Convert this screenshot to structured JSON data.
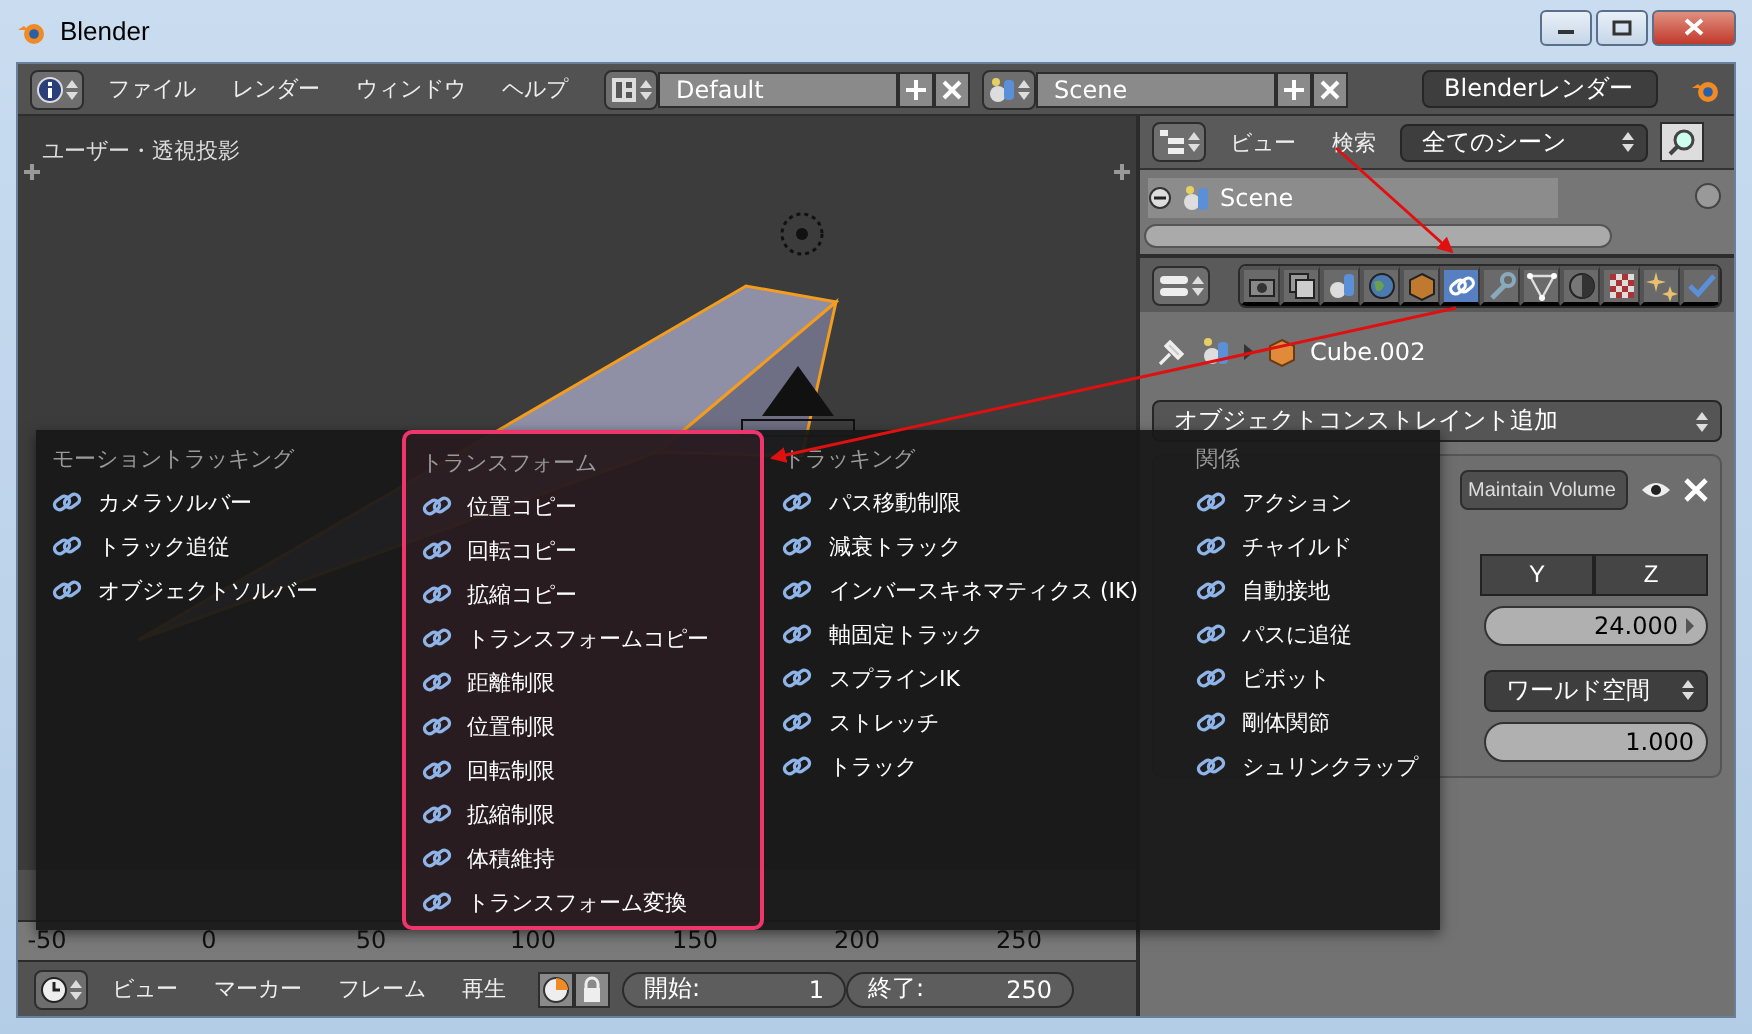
{
  "window": {
    "title": "Blender"
  },
  "top_bar": {
    "menu": [
      "ファイル",
      "レンダー",
      "ウィンドウ",
      "ヘルプ"
    ],
    "layout": "Default",
    "scene": "Scene",
    "engine": "Blenderレンダー"
  },
  "viewport": {
    "label": "ユーザー・透視投影"
  },
  "timeline": {
    "ruler": [
      "-50",
      "0",
      "50",
      "100",
      "150",
      "200",
      "250"
    ],
    "menu": [
      "ビュー",
      "マーカー",
      "フレーム",
      "再生"
    ],
    "start_label": "開始:",
    "start": "1",
    "end_label": "終了:",
    "end": "250"
  },
  "outliner": {
    "menu": [
      "ビュー",
      "検索"
    ],
    "filter": "全てのシーン",
    "tree": [
      {
        "label": "Scene",
        "expanded": true
      }
    ]
  },
  "properties": {
    "tabs": [
      {
        "kind": "render",
        "selected": false
      },
      {
        "kind": "layers",
        "selected": false
      },
      {
        "kind": "scene",
        "selected": false
      },
      {
        "kind": "world",
        "selected": false
      },
      {
        "kind": "object",
        "selected": false
      },
      {
        "kind": "constraints",
        "selected": true
      },
      {
        "kind": "modifiers",
        "selected": false
      },
      {
        "kind": "data",
        "selected": false
      },
      {
        "kind": "material",
        "selected": false
      },
      {
        "kind": "texture",
        "selected": false
      },
      {
        "kind": "particles",
        "selected": false
      },
      {
        "kind": "physics",
        "selected": false
      }
    ],
    "breadcrumb": "Cube.002",
    "add_constraint": "オブジェクトコンストレイント追加",
    "constraint": {
      "name": "Maintain Volume",
      "axes": [
        {
          "label": "Y",
          "selected": false
        },
        {
          "label": "Z",
          "selected": false
        }
      ],
      "volume": "24.000",
      "space": "ワールド空間",
      "influence": "1.000"
    }
  },
  "constraint_menu": {
    "columns": [
      {
        "title": "モーショントラッキング",
        "highlighted": false,
        "items": [
          "カメラソルバー",
          "トラック追従",
          "オブジェクトソルバー"
        ]
      },
      {
        "title": "トランスフォーム",
        "highlighted": true,
        "items": [
          "位置コピー",
          "回転コピー",
          "拡縮コピー",
          "トランスフォームコピー",
          "距離制限",
          "位置制限",
          "回転制限",
          "拡縮制限",
          "体積維持",
          "トランスフォーム変換"
        ]
      },
      {
        "title": "トラッキング",
        "highlighted": false,
        "items": [
          "パス移動制限",
          "減衰トラック",
          "インバースキネマティクス (IK)",
          "軸固定トラック",
          "スプラインIK",
          "ストレッチ",
          "トラック"
        ]
      },
      {
        "title": "関係",
        "highlighted": false,
        "items": [
          "アクション",
          "チャイルド",
          "自動接地",
          "パスに追従",
          "ピボット",
          "剛体関節",
          "シュリンクラップ"
        ]
      }
    ]
  }
}
